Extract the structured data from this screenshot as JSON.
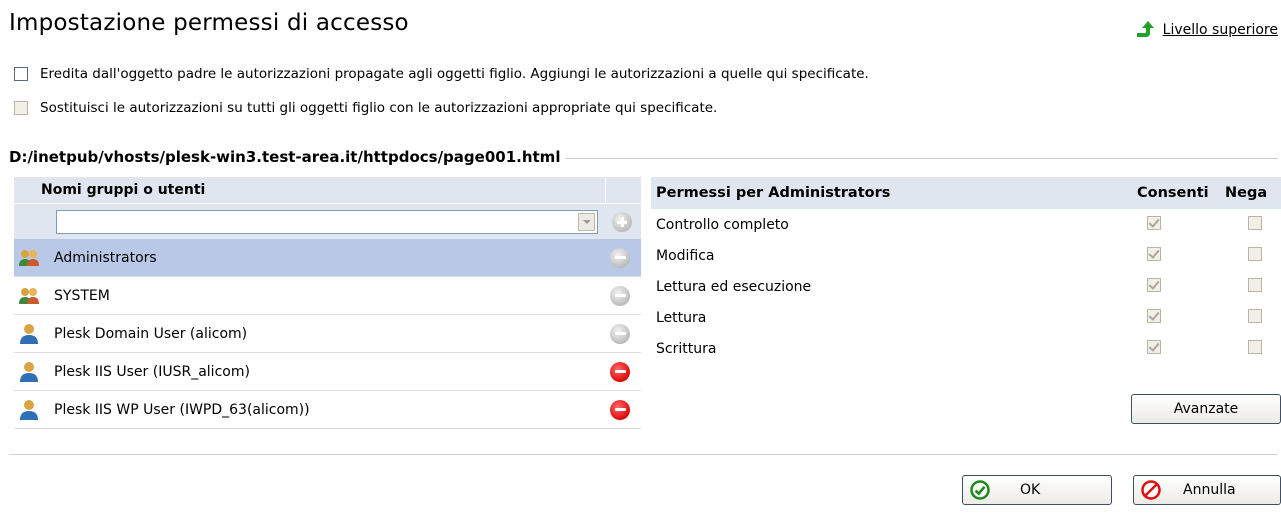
{
  "header": {
    "title": "Impostazione permessi di accesso",
    "up_level_label": "Livello superiore"
  },
  "options": [
    {
      "label": "Eredita dall'oggetto padre le autorizzazioni propagate agli oggetti figlio. Aggiungi le autorizzazioni a quelle qui specificate.",
      "checked": false,
      "enabled": true
    },
    {
      "label": "Sostituisci le autorizzazioni su tutti gli oggetti figlio con le autorizzazioni appropriate qui specificate.",
      "checked": false,
      "enabled": false
    }
  ],
  "object_path": "D:/inetpub/vhosts/plesk-win3.test-area.it/httpdocs/page001.html",
  "users_panel": {
    "header": "Nomi gruppi o utenti",
    "combo_value": "",
    "items": [
      {
        "name": "Administrators",
        "type": "group",
        "selected": true,
        "removable": false
      },
      {
        "name": "SYSTEM",
        "type": "group",
        "selected": false,
        "removable": false
      },
      {
        "name": "Plesk Domain User (alicom)",
        "type": "user",
        "selected": false,
        "removable": false
      },
      {
        "name": "Plesk IIS User (IUSR_alicom)",
        "type": "user",
        "selected": false,
        "removable": true
      },
      {
        "name": "Plesk IIS WP User (IWPD_63(alicom))",
        "type": "user",
        "selected": false,
        "removable": true
      }
    ]
  },
  "permissions_panel": {
    "header": "Permessi per Administrators",
    "allow_header": "Consenti",
    "deny_header": "Nega",
    "rows": [
      {
        "label": "Controllo completo",
        "allow": true,
        "deny": false
      },
      {
        "label": "Modifica",
        "allow": true,
        "deny": false
      },
      {
        "label": "Lettura ed esecuzione",
        "allow": true,
        "deny": false
      },
      {
        "label": "Lettura",
        "allow": true,
        "deny": false
      },
      {
        "label": "Scrittura",
        "allow": true,
        "deny": false
      }
    ],
    "advanced_label": "Avanzate"
  },
  "footer": {
    "ok_label": "OK",
    "cancel_label": "Annulla"
  },
  "colors": {
    "header_bg": "#dfe6f0",
    "selected_row": "#b8c8e6",
    "remove_red": "#e01010"
  }
}
